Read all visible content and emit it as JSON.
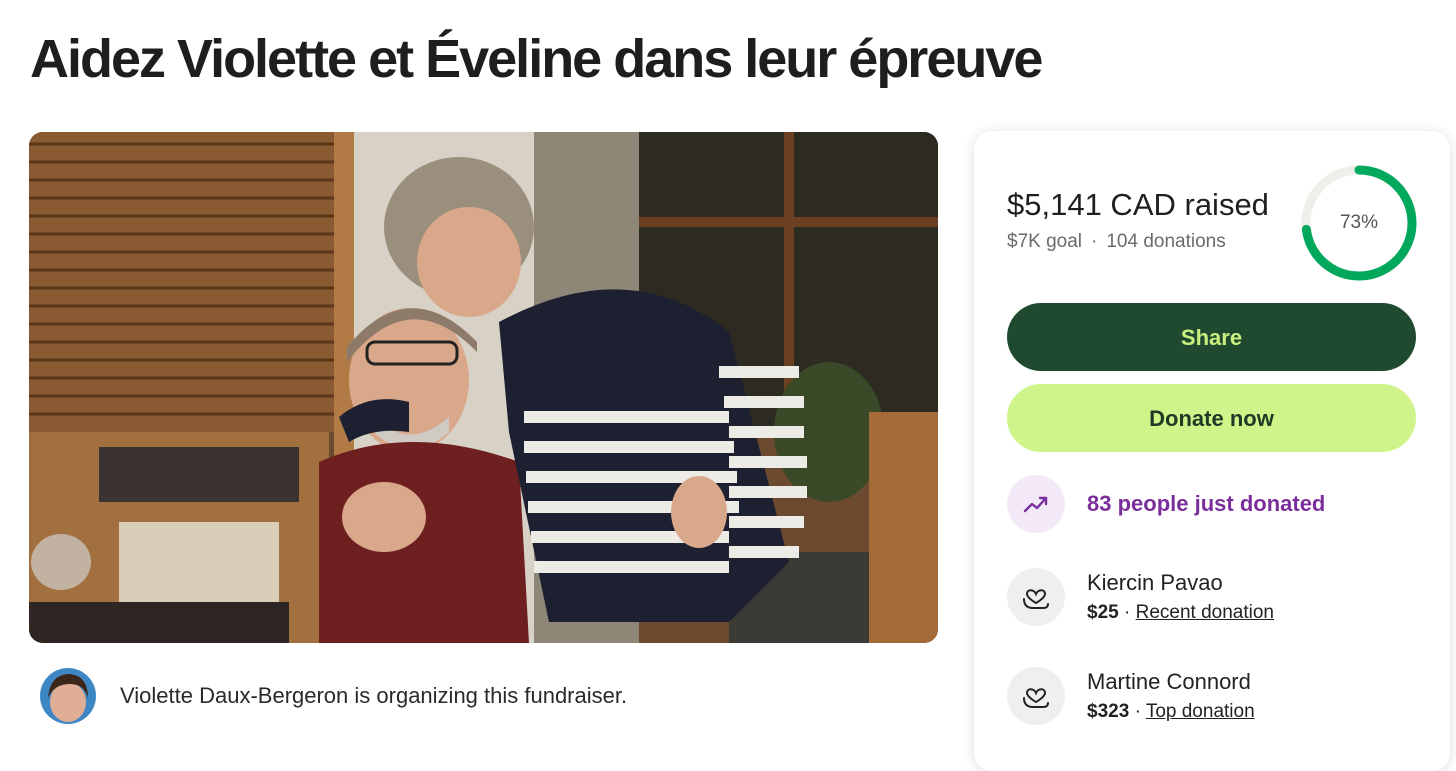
{
  "page": {
    "title": "Aidez Violette et Éveline dans leur épreuve"
  },
  "organizer": {
    "text": "Violette Daux-Bergeron is organizing this fundraiser."
  },
  "donation_card": {
    "raised_text": "$5,141 CAD raised",
    "goal_text": "$7K goal",
    "separator": "·",
    "donations_text": "104 donations",
    "progress_percent": 73,
    "progress_label": "73%",
    "progress_color": "#02a95c",
    "share_label": "Share",
    "donate_label": "Donate now",
    "trending_text": "83 people just donated",
    "donors": [
      {
        "name": "Kiercin Pavao",
        "amount": "$25",
        "separator": "·",
        "label": "Recent donation"
      },
      {
        "name": "Martine Connord",
        "amount": "$323",
        "separator": "·",
        "label": "Top donation"
      }
    ]
  },
  "icons": {
    "trend": "trending-up-icon",
    "donor": "heart-hand-icon"
  }
}
